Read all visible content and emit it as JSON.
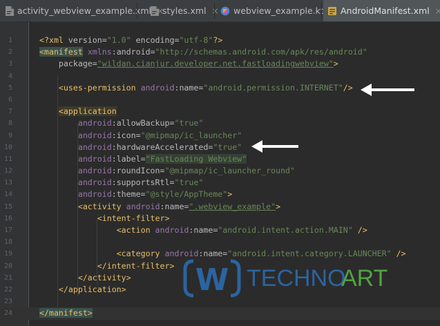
{
  "tabs": [
    {
      "label": "activity_webview_example.xml",
      "icon": "xml-file-icon",
      "active": false
    },
    {
      "label": "styles.xml",
      "icon": "xml-file-icon",
      "active": false
    },
    {
      "label": "webview_example.kt",
      "icon": "kotlin-file-icon",
      "active": false
    },
    {
      "label": "AndroidManifest.xml",
      "icon": "manifest-file-icon",
      "active": true
    }
  ],
  "close_glyph": "×",
  "code_lines": [
    {
      "n": "1",
      "t": "<?xml version=\"1.0\" encoding=\"utf-8\"?>"
    },
    {
      "n": "2",
      "t": "<manifest xmlns:android=\"http://schemas.android.com/apk/res/android\""
    },
    {
      "n": "3",
      "t": "    package=\"wildan.cianjur.developer.net.fastloadingwebview\">"
    },
    {
      "n": "4",
      "t": ""
    },
    {
      "n": "5",
      "t": "    <uses-permission android:name=\"android.permission.INTERNET\"/>"
    },
    {
      "n": "6",
      "t": ""
    },
    {
      "n": "7",
      "t": "    <application"
    },
    {
      "n": "8",
      "t": "        android:allowBackup=\"true\""
    },
    {
      "n": "9",
      "t": "        android:icon=\"@mipmap/ic_launcher\""
    },
    {
      "n": "10",
      "t": "        android:hardwareAccelerated=\"true\""
    },
    {
      "n": "11",
      "t": "        android:label=\"FastLoading Webview\""
    },
    {
      "n": "12",
      "t": "        android:roundIcon=\"@mipmap/ic_launcher_round\""
    },
    {
      "n": "13",
      "t": "        android:supportsRtl=\"true\""
    },
    {
      "n": "14",
      "t": "        android:theme=\"@style/AppTheme\">"
    },
    {
      "n": "15",
      "t": "        <activity android:name=\".webview_example\">"
    },
    {
      "n": "16",
      "t": "            <intent-filter>"
    },
    {
      "n": "17",
      "t": "                <action android:name=\"android.intent.action.MAIN\" />"
    },
    {
      "n": "18",
      "t": ""
    },
    {
      "n": "19",
      "t": "                <category android:name=\"android.intent.category.LAUNCHER\" />"
    },
    {
      "n": "20",
      "t": "            </intent-filter>"
    },
    {
      "n": "21",
      "t": "        </activity>"
    },
    {
      "n": "22",
      "t": "    </application>"
    },
    {
      "n": "23",
      "t": ""
    },
    {
      "n": "24",
      "t": "</manifest>"
    }
  ],
  "watermark": {
    "brand_left": "TECHNO",
    "brand_right": "ART",
    "logo_letter": "W"
  },
  "colors": {
    "background": "#2b2b2b",
    "tag": "#e8bf6a",
    "attribute": "#bababa",
    "namespace": "#9876aa",
    "value": "#6a8759",
    "arrow": "#ffffff",
    "watermark_blue": "#2c6fb5",
    "watermark_green": "#58b947"
  }
}
